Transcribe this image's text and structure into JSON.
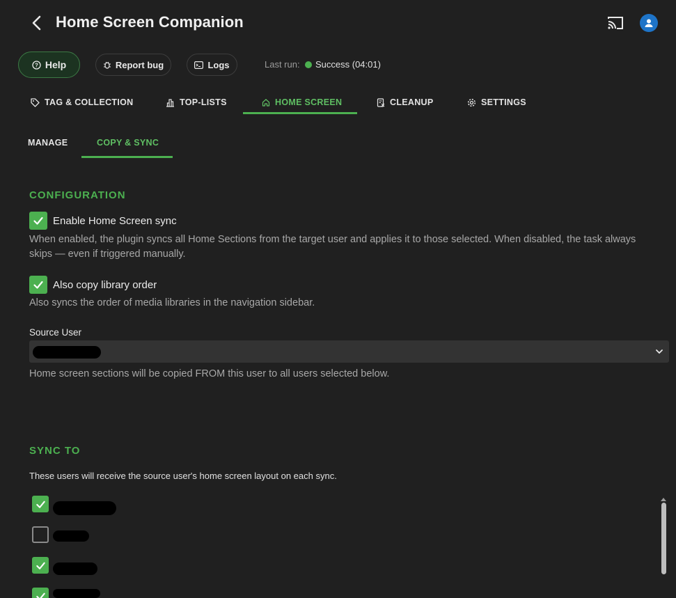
{
  "header": {
    "title": "Home Screen Companion",
    "back_icon": "chevron-left-icon",
    "cast_icon": "cast-icon",
    "avatar_icon": "user-icon"
  },
  "actions": {
    "help_label": "Help",
    "report_label": "Report bug",
    "logs_label": "Logs",
    "last_run_label": "Last run:",
    "status_text": "Success (04:01)",
    "status_color": "#4cb050"
  },
  "tabs": [
    {
      "label": "TAG & COLLECTION",
      "icon": "tag-icon"
    },
    {
      "label": "TOP-LISTS",
      "icon": "bar-chart-icon"
    },
    {
      "label": "HOME SCREEN",
      "icon": "home-icon",
      "active": true
    },
    {
      "label": "CLEANUP",
      "icon": "cleanup-icon"
    },
    {
      "label": "SETTINGS",
      "icon": "gear-icon"
    }
  ],
  "subtabs": [
    {
      "label": "MANAGE"
    },
    {
      "label": "COPY & SYNC",
      "active": true
    }
  ],
  "configuration": {
    "title": "CONFIGURATION",
    "enable_sync": {
      "label": "Enable Home Screen sync",
      "checked": true,
      "description": "When enabled, the plugin syncs all Home Sections from the target user and applies it to those selected. When disabled, the task always skips — even if triggered manually."
    },
    "copy_order": {
      "label": "Also copy library order",
      "checked": true,
      "description": "Also syncs the order of media libraries in the navigation sidebar."
    },
    "source_user": {
      "label": "Source User",
      "value": "",
      "description": "Home screen sections will be copied FROM this user to all users selected below."
    }
  },
  "sync_to": {
    "title": "SYNC TO",
    "description": "These users will receive the source user's home screen layout on each sync.",
    "users": [
      {
        "checked": true
      },
      {
        "checked": false
      },
      {
        "checked": true
      },
      {
        "checked": true
      }
    ]
  },
  "colors": {
    "accent": "#4cb050",
    "background": "#202020"
  }
}
